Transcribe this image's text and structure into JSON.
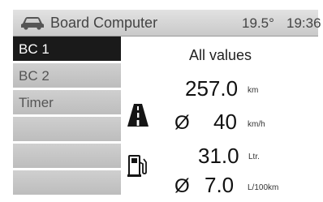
{
  "titlebar": {
    "title": "Board Computer",
    "temperature": "19.5°",
    "time": "19:36",
    "icon": "car-icon"
  },
  "sidebar": {
    "items": [
      {
        "label": "BC 1",
        "active": true
      },
      {
        "label": "BC 2",
        "active": false
      },
      {
        "label": "Timer",
        "active": false
      },
      {
        "label": "",
        "active": false
      },
      {
        "label": "",
        "active": false
      },
      {
        "label": "",
        "active": false
      }
    ]
  },
  "main": {
    "heading": "All values",
    "distance": {
      "value": "257.0",
      "unit": "km",
      "icon": "road-icon"
    },
    "avg_speed": {
      "symbol": "Ø",
      "value": "40",
      "unit": "km/h"
    },
    "fuel_used": {
      "value": "31.0",
      "unit": "Ltr.",
      "icon": "fuel-pump-icon"
    },
    "avg_consumption": {
      "symbol": "Ø",
      "value": "7.0",
      "unit": "L/100km"
    }
  }
}
